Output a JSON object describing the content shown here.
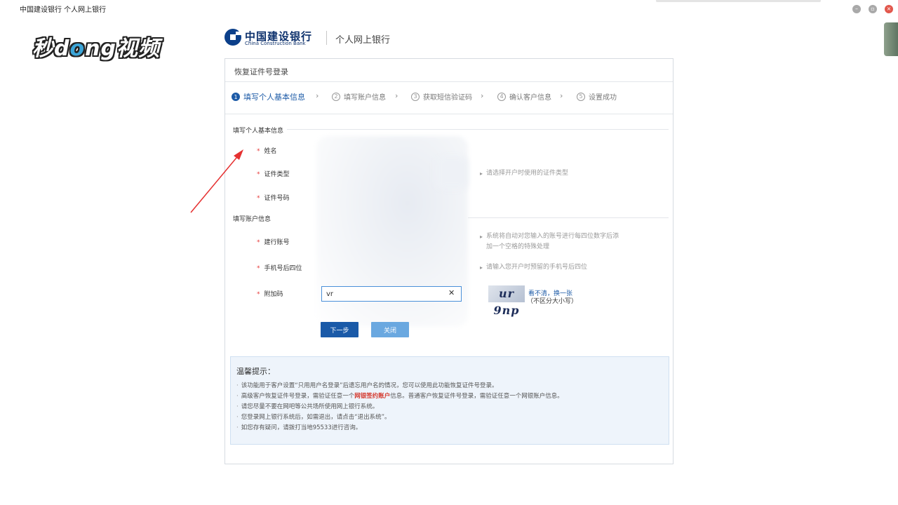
{
  "window": {
    "title": "中国建设银行 个人网上银行"
  },
  "watermark": {
    "text_a": "秒d",
    "text_o": "o",
    "text_b": "ng视频"
  },
  "header": {
    "bank_name_cn": "中国建设银行",
    "bank_name_en": "China Construction Bank",
    "subtitle": "个人网上银行"
  },
  "panel": {
    "title": "恢复证件号登录"
  },
  "steps": [
    {
      "num": "1",
      "label": "填写个人基本信息"
    },
    {
      "num": "2",
      "label": "填写账户信息"
    },
    {
      "num": "3",
      "label": "获取短信验证码"
    },
    {
      "num": "4",
      "label": "确认客户信息"
    },
    {
      "num": "5",
      "label": "设置成功"
    }
  ],
  "step_arrow": "›",
  "sections": {
    "personal": "填写个人基本信息",
    "account": "填写账户信息"
  },
  "fields": {
    "required_mark": "*",
    "name": "姓名",
    "id_type": "证件类型",
    "id_number": "证件号码",
    "account_number": "建行账号",
    "phone_last4": "手机号后四位",
    "captcha": "附加码"
  },
  "hints": {
    "id_type": "请选择开户时使用的证件类型",
    "account_line1": "系统将自动对您输入的账号进行每四位数字后添",
    "account_line2": "加一个空格的特殊处理",
    "phone": "请输入您开户时预留的手机号后四位"
  },
  "captcha": {
    "value": "vr",
    "image_text": "ur 9np",
    "refresh": "看不清，换一张",
    "note": "（不区分大小写）"
  },
  "buttons": {
    "next": "下一步",
    "close": "关闭"
  },
  "tips": {
    "title": "温馨提示：",
    "item1": "该功能用于客户设置“只用用户名登录”后遗忘用户名的情况，您可以使用此功能恢复证件号登录。",
    "item2_a": "高级客户恢复证件号登录，需验证任意一个",
    "item2_em": "网银签约账户",
    "item2_b": "信息。普通客户恢复证件号登录，需验证任意一个网银账户信息。",
    "item3": "请您尽量不要在网吧等公共场所使用网上银行系统。",
    "item4": "您登录网上银行系统后，如需退出，请点击“退出系统”。",
    "item5": "如您存有疑问，请拨打当地95533进行咨询。"
  },
  "icons": {
    "minimize": "minimize-icon",
    "maximize": "restore-icon",
    "close": "close-icon",
    "clear": "clear-icon",
    "logo": "ccb-logo-icon",
    "annotation": "red-arrow-icon"
  },
  "colors": {
    "brand_blue": "#1a5aa8",
    "active_step": "#1d5ba7",
    "required_red": "#e63b3b",
    "tip_highlight": "#d43a2f",
    "annotation_red": "#e53030"
  }
}
